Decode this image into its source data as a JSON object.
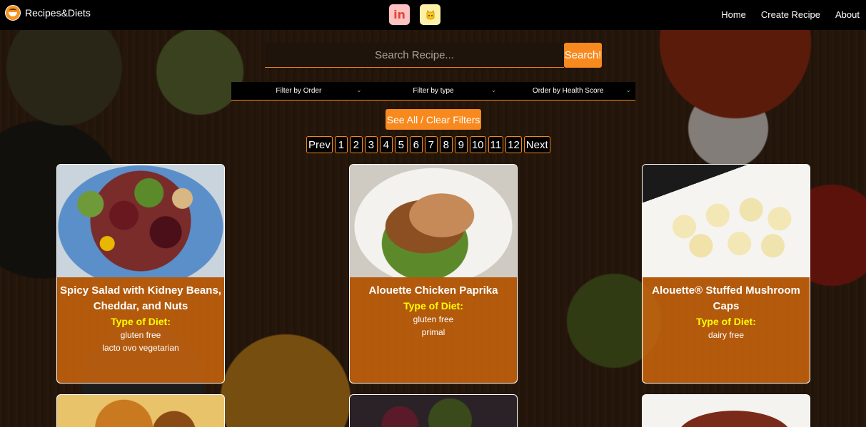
{
  "navbar": {
    "brand_name": "Recipes&Diets",
    "social": [
      {
        "name": "linkedin",
        "glyph": "in",
        "color": "#e0453a"
      },
      {
        "name": "github",
        "glyph": "",
        "color": "#f7c51e"
      }
    ],
    "links": [
      "Home",
      "Create Recipe",
      "About"
    ]
  },
  "search": {
    "placeholder": "Search Recipe...",
    "value": "",
    "button_label": "Search!"
  },
  "filters": {
    "order": "Filter by Order",
    "type": "Filter by type",
    "health": "Order by Health Score"
  },
  "clear_button_label": "See All / Clear Filters",
  "pagination": {
    "prev": "Prev",
    "pages": [
      "1",
      "2",
      "3",
      "4",
      "5",
      "6",
      "7",
      "8",
      "9",
      "10",
      "11",
      "12"
    ],
    "next": "Next"
  },
  "diet_label": "Type of Diet:",
  "recipes": [
    {
      "title": "Spicy Salad with Kidney Beans, Cheddar, and Nuts",
      "diets": [
        "gluten free",
        "lacto ovo vegetarian"
      ]
    },
    {
      "title": "Alouette Chicken Paprika",
      "diets": [
        "gluten free",
        "primal"
      ]
    },
    {
      "title": "Alouette® Stuffed Mushroom Caps",
      "diets": [
        "dairy free"
      ]
    }
  ],
  "colors": {
    "accent": "#f7891e",
    "card_bg": "#d3690e",
    "diet_label": "#ffff00",
    "navbar": "#000000"
  }
}
